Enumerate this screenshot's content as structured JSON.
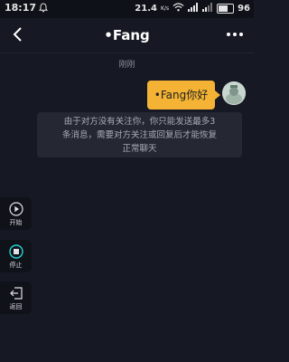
{
  "status_bar": {
    "time": "18:17",
    "speed": "21.4",
    "speed_unit": "K/s",
    "battery": "96",
    "icons": [
      "notification-icon",
      "wifi-icon",
      "signal-icon",
      "signal-icon",
      "battery-icon"
    ]
  },
  "nav": {
    "title": "•Fang",
    "back_icon": "chevron-left-icon",
    "more_icon": "more-dots-icon"
  },
  "chat": {
    "timestamp": "刚刚",
    "message": "•Fang你好",
    "notice_line1": "由于对方没有关注你，你只能发送最多3",
    "notice_line2": "条消息，需要对方关注或回复后才能恢复",
    "notice_line3": "正常聊天"
  },
  "side_controls": {
    "start_label": "开始",
    "stop_label": "停止",
    "back_label": "返回"
  },
  "colors": {
    "background": "#161823",
    "bubble": "#f4b334",
    "notice_bg": "#252733",
    "stop_accent": "#23d3cf"
  }
}
